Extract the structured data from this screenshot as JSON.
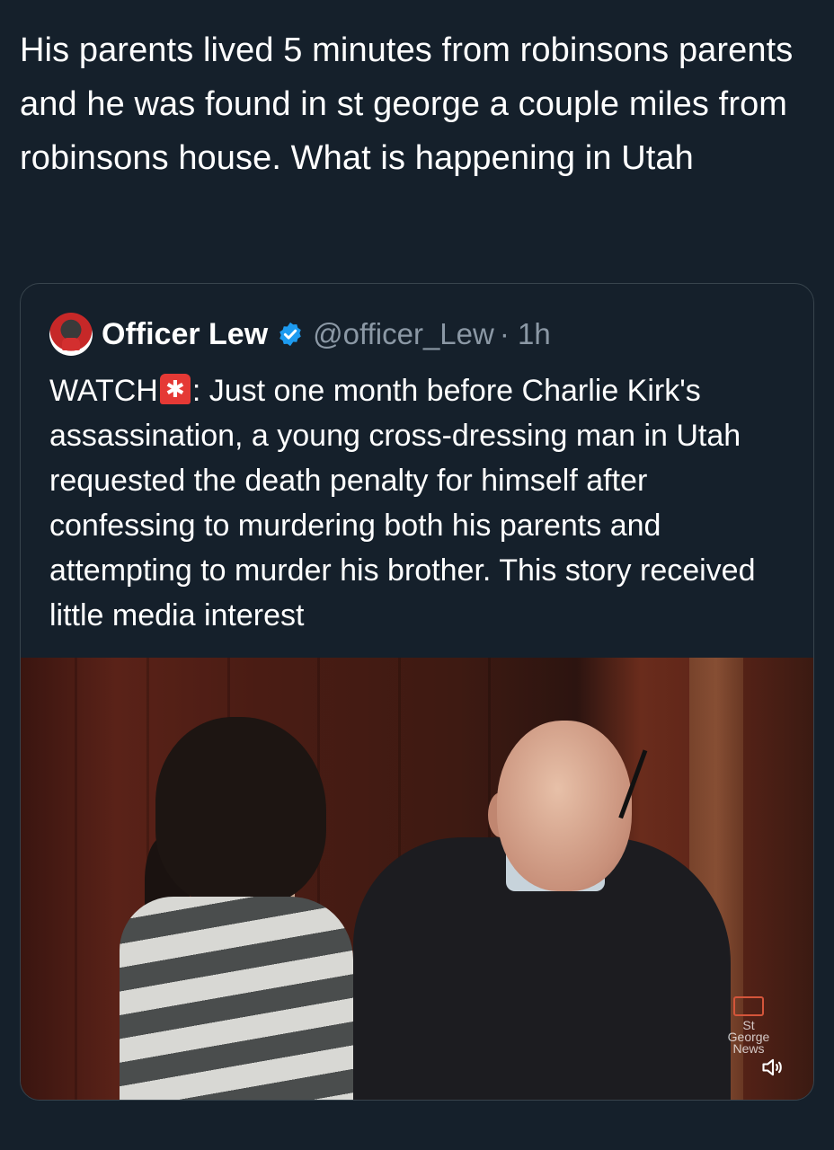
{
  "post": {
    "text": "His parents lived 5 minutes from robinsons parents and he was found in st george a couple miles from robinsons house. What is happening in Utah"
  },
  "quote": {
    "author_name": "Officer Lew",
    "verified": true,
    "handle": "@officer_Lew",
    "time": "· 1h",
    "body_lead": "WATCH",
    "body_rest": ": Just one month before Charlie Kirk's assassination, a young cross-dressing man in Utah requested the death penalty for himself after confessing to murdering both his parents and attempting to murder his brother. This story received little media interest",
    "media": {
      "watermark_text": "St George News",
      "volume_icon": "speaker-icon"
    }
  },
  "colors": {
    "background": "#15202b",
    "text": "#ffffff",
    "muted": "#8b98a5",
    "verified": "#1d9bf0",
    "border": "#38444d"
  }
}
